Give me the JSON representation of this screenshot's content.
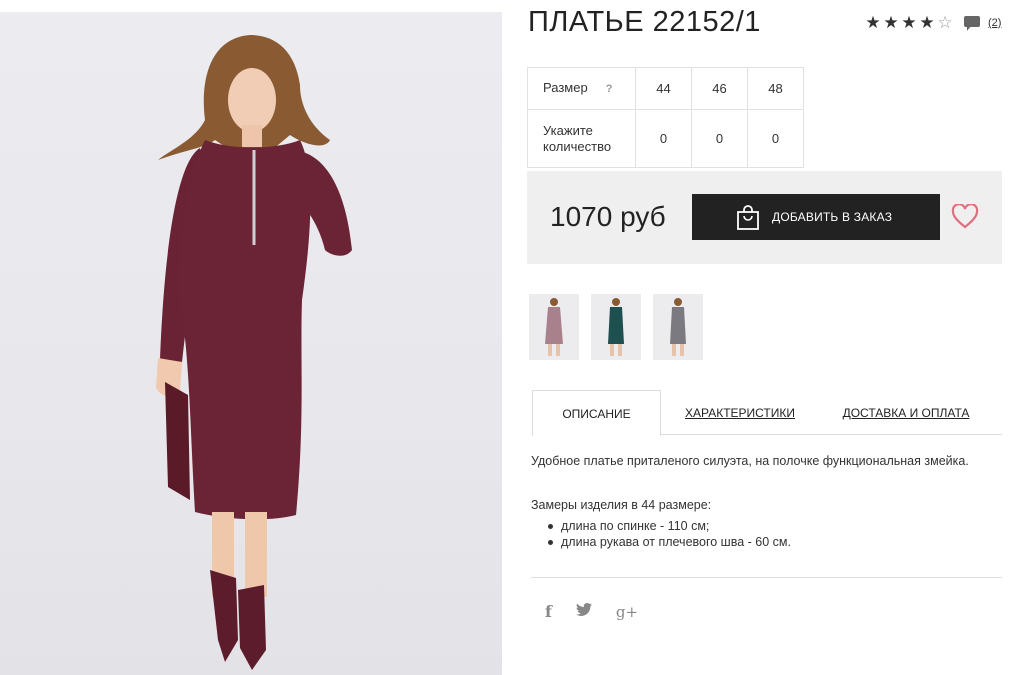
{
  "product": {
    "title": "ПЛАТЬЕ 22152/1",
    "rating_stars": 4,
    "rating_max": 5,
    "review_count": "(2)"
  },
  "sizes": {
    "size_label": "Размер",
    "help": "?",
    "values": [
      "44",
      "46",
      "48"
    ],
    "qty_label_line1": "Укажите",
    "qty_label_line2": "количество",
    "quantities": [
      "0",
      "0",
      "0"
    ]
  },
  "order": {
    "price": "1070 руб",
    "add_button": "ДОБАВИТЬ В ЗАКАЗ"
  },
  "tabs": [
    {
      "label": "ОПИСАНИЕ",
      "active": true
    },
    {
      "label": "ХАРАКТЕРИСТИКИ",
      "active": false
    },
    {
      "label": "ДОСТАВКА И ОПЛАТА",
      "active": false
    }
  ],
  "description": {
    "text": "Удобное платье приталеного силуэта, на полочке функциональная змейка.",
    "measures_title": "Замеры изделия в 44 размере:",
    "measures": [
      "длина по спинке - 110 см;",
      "длина рукава от плечевого шва - 60 см."
    ]
  },
  "social": {
    "facebook": "f",
    "twitter": "🐦",
    "google_plus": "g+"
  },
  "colors": {
    "dress_main": "#6b2436",
    "accent_heart": "#e0707f",
    "button_bg": "#222222",
    "thumb_colors": [
      "#a9818c",
      "#1f5050",
      "#7a7a80"
    ]
  }
}
